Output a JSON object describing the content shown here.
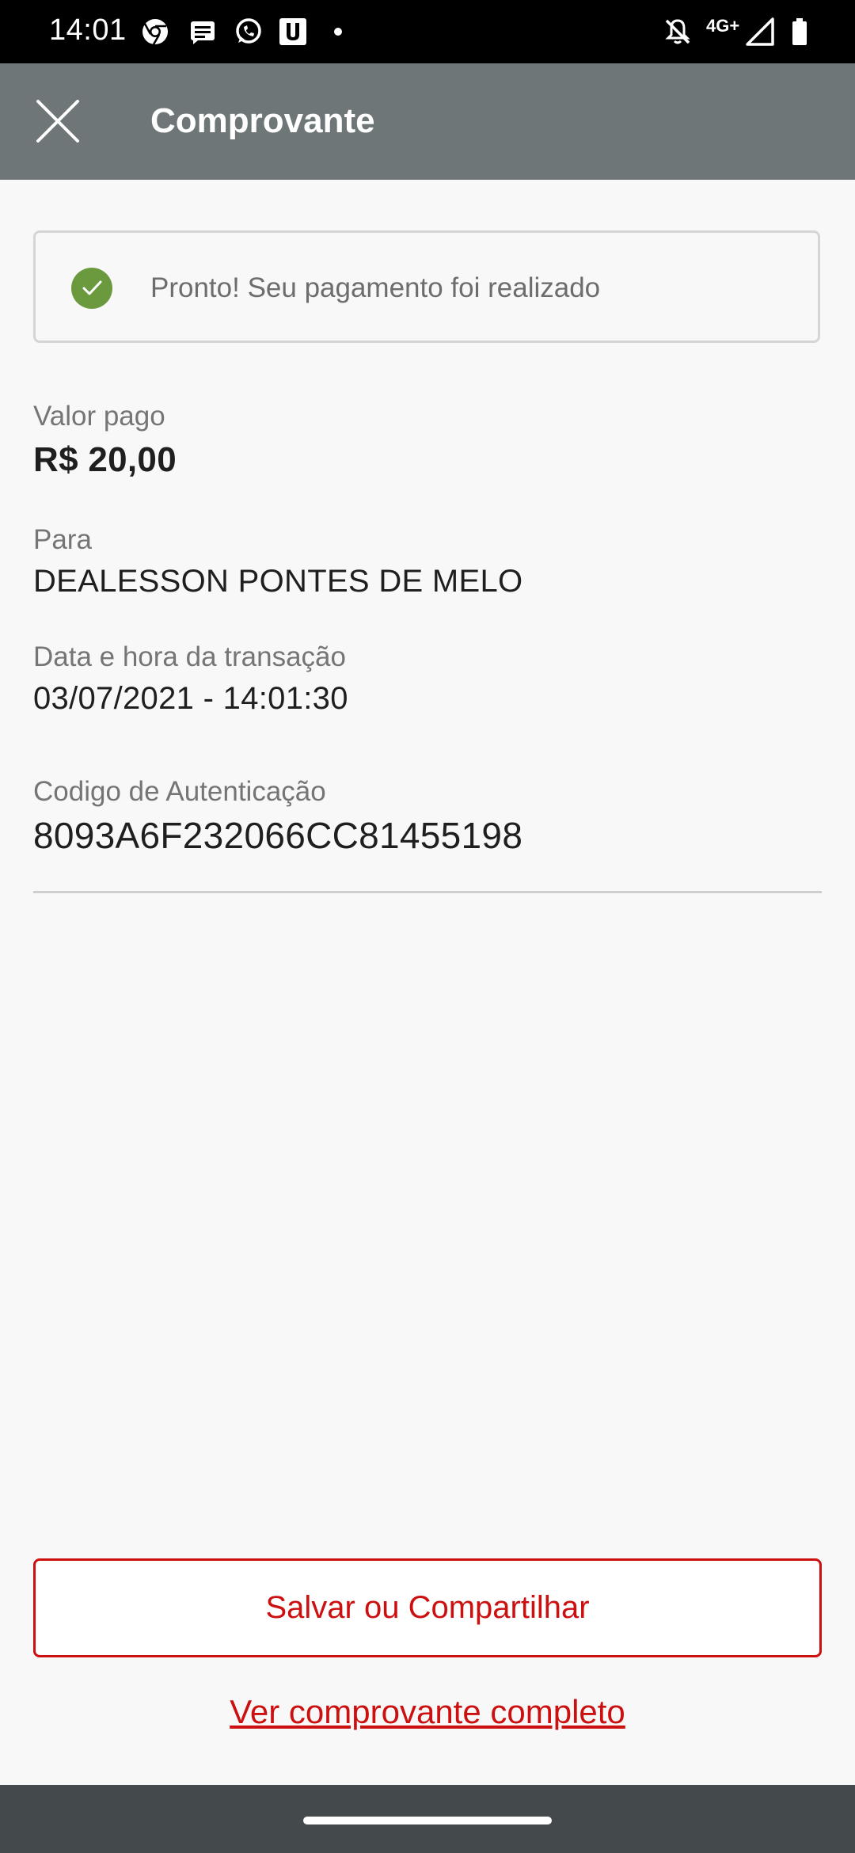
{
  "status_bar": {
    "time": "14:01",
    "network": "4G+",
    "icons": [
      "chrome-icon",
      "message-icon",
      "whatsapp-icon",
      "u-app-icon",
      "notification-dot",
      "mute-icon",
      "signal-icon",
      "battery-icon"
    ]
  },
  "app_bar": {
    "title": "Comprovante",
    "close_icon": "close-icon"
  },
  "banner": {
    "message": "Pronto! Seu pagamento foi realizado",
    "icon": "check-icon",
    "icon_color": "#6a9a3d"
  },
  "fields": {
    "amount": {
      "label": "Valor pago",
      "value": "R$ 20,00"
    },
    "recipient": {
      "label": "Para",
      "value": "DEALESSON PONTES DE MELO"
    },
    "datetime": {
      "label": "Data e hora da transação",
      "value": "03/07/2021 - 14:01:30"
    },
    "auth_code": {
      "label": "Codigo de Autenticação",
      "value": "8093A6F232066CC81455198"
    }
  },
  "actions": {
    "save_share": "Salvar ou Compartilhar",
    "view_full": "Ver comprovante completo"
  },
  "colors": {
    "accent": "#cc0f0f",
    "app_bar": "#6e7677",
    "success": "#6a9a3d"
  }
}
